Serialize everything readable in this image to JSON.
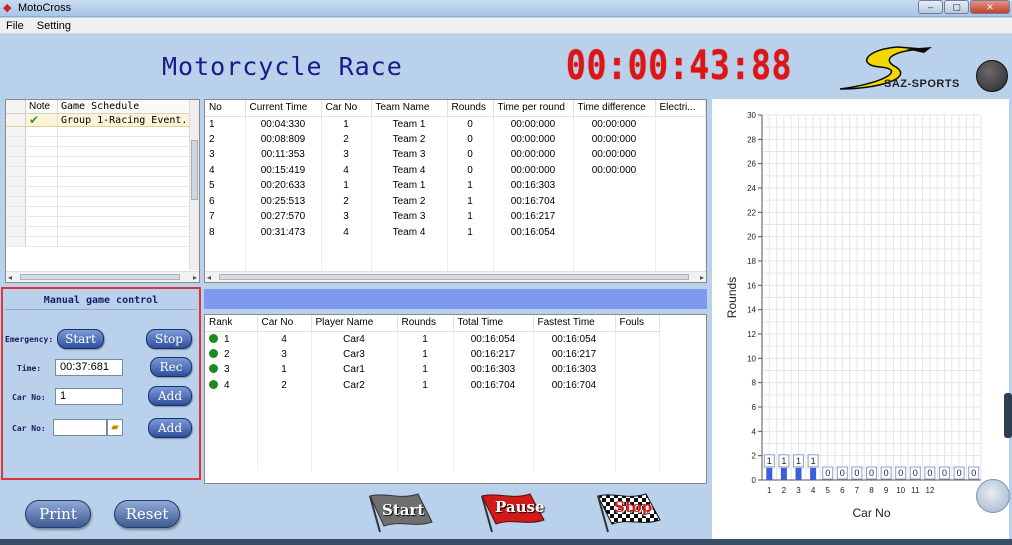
{
  "window": {
    "title": "MotoCross",
    "controls": [
      "–",
      "▢",
      "✕"
    ]
  },
  "menu": {
    "items": [
      "File",
      "Setting"
    ]
  },
  "header": {
    "title": "Motorcycle Race",
    "timer": "00:00:43:88",
    "logo_text": "SAZ-SPORTS",
    "accent": "#e01414"
  },
  "schedule": {
    "headers": [
      "Note",
      "Game Schedule"
    ],
    "rows": [
      {
        "note_icon": "check-icon",
        "schedule": "Group 1-Racing Event..."
      }
    ]
  },
  "results": {
    "headers": [
      "No",
      "Current Time",
      "Car No",
      "Team Name",
      "Rounds",
      "Time per round",
      "Time difference",
      "Electri..."
    ],
    "rows": [
      [
        "1",
        "00:04:330",
        "1",
        "Team 1",
        "0",
        "00:00:000",
        "00:00:000",
        ""
      ],
      [
        "2",
        "00:08:809",
        "2",
        "Team 2",
        "0",
        "00:00:000",
        "00:00:000",
        ""
      ],
      [
        "3",
        "00:11:353",
        "3",
        "Team 3",
        "0",
        "00:00:000",
        "00:00:000",
        ""
      ],
      [
        "4",
        "00:15:419",
        "4",
        "Team 4",
        "0",
        "00:00:000",
        "00:00:000",
        ""
      ],
      [
        "5",
        "00:20:633",
        "1",
        "Team 1",
        "1",
        "00:16:303",
        "",
        ""
      ],
      [
        "6",
        "00:25:513",
        "2",
        "Team 2",
        "1",
        "00:16:704",
        "",
        ""
      ],
      [
        "7",
        "00:27:570",
        "3",
        "Team 3",
        "1",
        "00:16:217",
        "",
        ""
      ],
      [
        "8",
        "00:31:473",
        "4",
        "Team 4",
        "1",
        "00:16:054",
        "",
        ""
      ]
    ]
  },
  "ranking": {
    "headers": [
      "Rank",
      "Car No",
      "Player Name",
      "Rounds",
      "Total Time",
      "Fastest Time",
      "Fouls"
    ],
    "rows": [
      [
        "1",
        "4",
        "Car4",
        "1",
        "00:16:054",
        "00:16:054",
        ""
      ],
      [
        "2",
        "3",
        "Car3",
        "1",
        "00:16:217",
        "00:16:217",
        ""
      ],
      [
        "3",
        "1",
        "Car1",
        "1",
        "00:16:303",
        "00:16:303",
        ""
      ],
      [
        "4",
        "2",
        "Car2",
        "1",
        "00:16:704",
        "00:16:704",
        ""
      ]
    ]
  },
  "manual": {
    "title": "Manual game control",
    "emergency_label": "Emergency:",
    "start_label": "Start",
    "stop_label": "Stop",
    "time_label": "Time:",
    "time_value": "00:37:681",
    "rec_label": "Rec",
    "carno_label": "Car No:",
    "carno_value": "1",
    "add_label": "Add",
    "carno2_label": "Car No:",
    "carno2_value": "",
    "add2_label": "Add"
  },
  "bottom": {
    "print_label": "Print",
    "reset_label": "Reset",
    "start_label": "Start",
    "pause_label": "Pause",
    "stop_label": "Stop"
  },
  "chart_data": {
    "type": "bar",
    "xlabel": "Car No",
    "ylabel": "Rounds",
    "ylim": [
      0,
      30
    ],
    "yticks": [
      0,
      2,
      4,
      6,
      8,
      10,
      12,
      14,
      16,
      18,
      20,
      22,
      24,
      26,
      28,
      30
    ],
    "categories": [
      "1",
      "2",
      "3",
      "4",
      "5",
      "6",
      "7",
      "8",
      "9",
      "10",
      "11",
      "12",
      "",
      "",
      ""
    ],
    "values": [
      1,
      1,
      1,
      1,
      0,
      0,
      0,
      0,
      0,
      0,
      0,
      0,
      0,
      0,
      0
    ],
    "bar_color": "#3a5fd8",
    "grid": true
  }
}
